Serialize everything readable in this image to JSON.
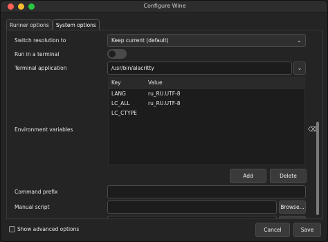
{
  "window": {
    "title": "Configure Wine"
  },
  "tabs": [
    {
      "label": "Runner options"
    },
    {
      "label": "System options"
    }
  ],
  "fields": {
    "switch_resolution": {
      "label": "Switch resolution to",
      "value": "Keep current (default)"
    },
    "run_in_terminal": {
      "label": "Run in a terminal",
      "state": "off"
    },
    "terminal_application": {
      "label": "Terminal application",
      "value": "/usr/bin/alacritty"
    },
    "environment_variables": {
      "label": "Environment variables",
      "columns": [
        "Key",
        "Value"
      ],
      "rows": [
        {
          "key": "LANG",
          "value": "ru_RU.UTF-8"
        },
        {
          "key": "LC_ALL",
          "value": "ru_RU.UTF-8"
        },
        {
          "key": "LC_CTYPE",
          "value": ""
        }
      ],
      "add_label": "Add",
      "delete_label": "Delete"
    },
    "command_prefix": {
      "label": "Command prefix",
      "value": ""
    },
    "manual_script": {
      "label": "Manual script",
      "value": "",
      "browse_label": "Browse..."
    }
  },
  "footer": {
    "show_advanced_label": "Show advanced options",
    "cancel_label": "Cancel",
    "save_label": "Save"
  },
  "icons": {
    "dropdown": "chevron-down-icon",
    "clear": "backspace-icon"
  },
  "colors": {
    "close": "#ff5f57",
    "minimize": "#febc2e",
    "maximize": "#28c840"
  }
}
